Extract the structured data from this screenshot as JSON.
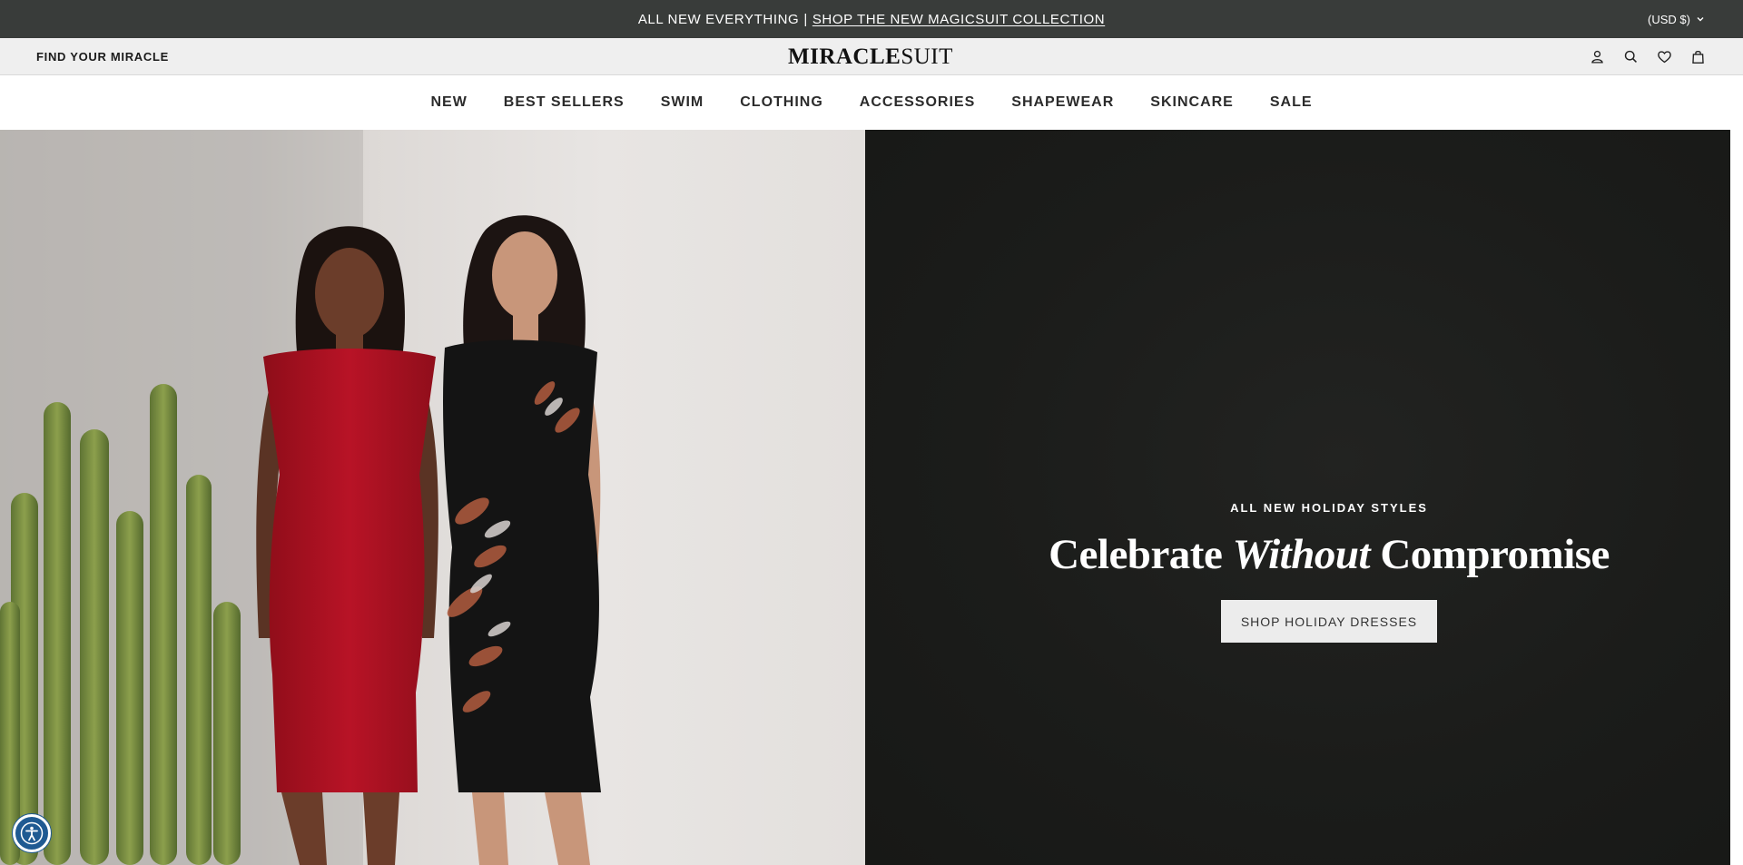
{
  "announcement": {
    "prefix": "ALL NEW EVERYTHING",
    "separator": "|",
    "link": "SHOP THE NEW MAGICSUIT COLLECTION"
  },
  "currency": {
    "label": "(USD $)",
    "icon": "chevron-down-icon"
  },
  "utility": {
    "find_label": "FIND YOUR MIRACLE",
    "logo_bold": "MIRACLE",
    "logo_light": "SUIT",
    "icons": [
      "account-icon",
      "search-icon",
      "wishlist-heart-icon",
      "cart-bag-icon"
    ]
  },
  "nav": {
    "items": [
      "NEW",
      "BEST SELLERS",
      "SWIM",
      "CLOTHING",
      "ACCESSORIES",
      "SHAPEWEAR",
      "SKINCARE",
      "SALE"
    ]
  },
  "hero": {
    "eyebrow": "ALL NEW HOLIDAY STYLES",
    "headline_start": "Celebrate ",
    "headline_italic": "Without",
    "headline_end": " Compromise",
    "cta": "SHOP HOLIDAY DRESSES"
  },
  "accessibility": {
    "icon": "accessibility-icon"
  },
  "colors": {
    "announce_bg": "#393c3a",
    "utility_bg": "#efefef",
    "hero_panel_bg": "#1b1c1a",
    "cta_bg": "#ececec",
    "accessibility_bg": "#1f5a92"
  }
}
